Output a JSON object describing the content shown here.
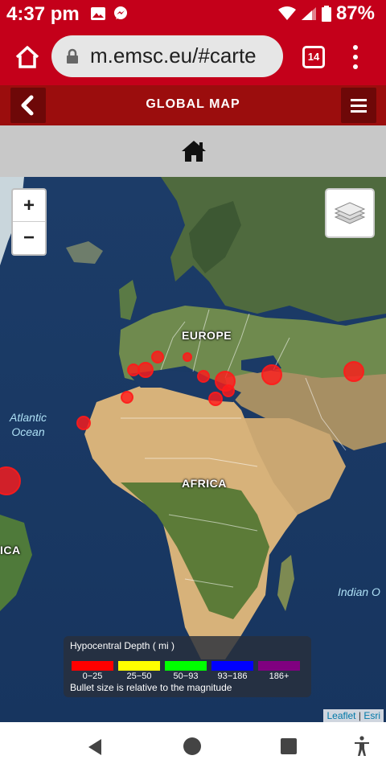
{
  "status_bar": {
    "time": "4:37 pm",
    "battery": "87%",
    "icons": [
      "image-icon",
      "messenger-icon",
      "wifi-icon",
      "signal-icon",
      "battery-icon"
    ]
  },
  "browser": {
    "url": "m.emsc.eu/#carte",
    "tab_count": "14"
  },
  "header": {
    "title": "GLOBAL MAP",
    "back_icon": "chevron-left-icon",
    "menu_icon": "hamburger-icon"
  },
  "home_strip": {
    "icon": "home-icon"
  },
  "map": {
    "zoom_in": "+",
    "zoom_out": "−",
    "labels": {
      "europe": "EUROPE",
      "africa": "AFRICA",
      "america_partial": "ICA",
      "atlantic": "Atlantic Ocean",
      "indian": "Indian O"
    },
    "legend": {
      "title": "Hypocentral Depth ( mi )",
      "ranges": [
        {
          "label": "0−25",
          "color": "#ff0000"
        },
        {
          "label": "25−50",
          "color": "#ffff00"
        },
        {
          "label": "50−93",
          "color": "#00ff00"
        },
        {
          "label": "93−186",
          "color": "#0000ff"
        },
        {
          "label": "186+",
          "color": "#800080"
        }
      ],
      "note": "Bullet size is relative to the magnitude"
    },
    "attribution": {
      "leaflet": "Leaflet",
      "sep": "|",
      "esri": "Esri"
    },
    "marker_color": "#ff1a1a"
  },
  "accent_colors": {
    "status": "#c4001a",
    "header": "#9b0d0d"
  }
}
